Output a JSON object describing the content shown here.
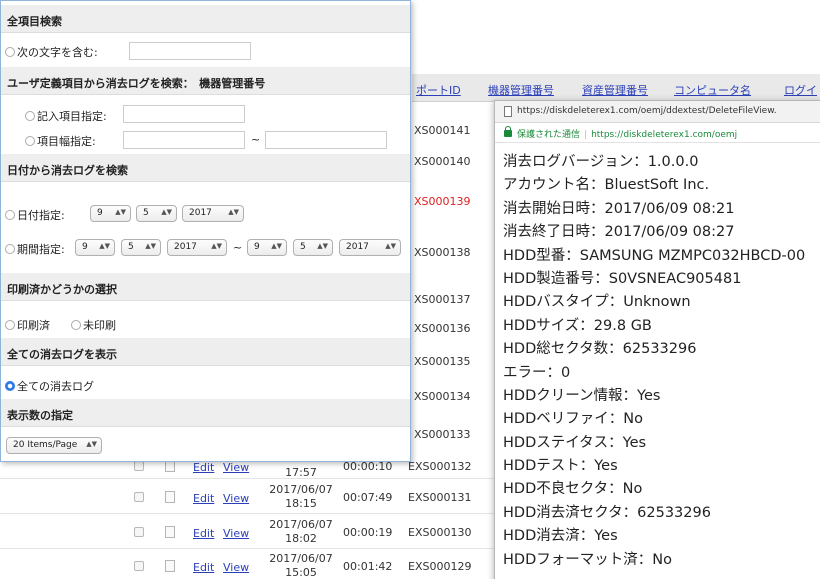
{
  "search_panel": {
    "all_items_title": "全項目検索",
    "contains_label": "次の文字を含む:",
    "user_defined_title": "ユーザ定義項目から消去ログを検索：　機器管理番号",
    "entry_spec_label": "記入項目指定:",
    "range_spec_label": "項目幅指定:",
    "tilde": "~",
    "date_title": "日付から消去ログを検索",
    "date_spec_label": "日付指定:",
    "date_spec": {
      "month": "9",
      "day": "5",
      "year": "2017"
    },
    "period_spec_label": "期間指定:",
    "period_from": {
      "month": "9",
      "day": "5",
      "year": "2017"
    },
    "period_to": {
      "month": "9",
      "day": "5",
      "year": "2017"
    },
    "printed_title": "印刷済かどうかの選択",
    "printed_label": "印刷済",
    "unprinted_label": "未印刷",
    "show_all_title": "全ての消去ログを表示",
    "all_logs_label": "全ての消去ログ",
    "display_count_title": "表示数の指定",
    "items_per_page": "20 Items/Page"
  },
  "table": {
    "headers": [
      "ポートID",
      "機器管理番号",
      "資産管理番号",
      "コンピュータ名",
      "ログイ"
    ],
    "ids": [
      "XS000141",
      "XS000140",
      "XS000139",
      "XS000138",
      "XS000137",
      "XS000136",
      "XS000135",
      "XS000134",
      "XS000133",
      "EXS000132",
      "EXS000131",
      "EXS000130",
      "EXS000129"
    ],
    "highlight_id": "XS000139",
    "visible_rows": [
      {
        "edit": "Edit",
        "view": "View",
        "date": "",
        "time": "17:57",
        "duration": "00:00:10",
        "id": "EXS000132"
      },
      {
        "edit": "Edit",
        "view": "View",
        "date": "2017/06/07",
        "time": "18:15",
        "duration": "00:07:49",
        "id": "EXS000131"
      },
      {
        "edit": "Edit",
        "view": "View",
        "date": "2017/06/07",
        "time": "18:02",
        "duration": "00:00:19",
        "id": "EXS000130"
      },
      {
        "edit": "Edit",
        "view": "View",
        "date": "2017/06/07",
        "time": "15:05",
        "duration": "00:01:42",
        "id": "EXS000129"
      }
    ]
  },
  "popup": {
    "url": "https://diskdeleterex1.com/oemj/ddextest/DeleteFileView.",
    "secure_label": "保護された通信",
    "secure_url": "https://diskdeleterex1.com/oemj",
    "lines": [
      "消去ログバージョン：1.0.0.0",
      "アカウント名：BluestSoft Inc.",
      "消去開始日時：2017/06/09 08:21",
      "消去終了日時：2017/06/09 08:27",
      "HDD型番：SAMSUNG MZMPC032HBCD-00",
      "HDD製造番号：S0VSNEAC905481",
      "HDDバスタイプ：Unknown",
      "HDDサイズ：29.8 GB",
      "HDD総セクタ数：62533296",
      "エラー：0",
      "HDDクリーン情報：Yes",
      "HDDベリファイ：No",
      "HDDステイタス：Yes",
      "HDDテスト：Yes",
      "HDD不良セクタ：No",
      "HDD消去済セクタ：62533296",
      "HDD消去済：Yes",
      "HDDフォーマット済：No"
    ]
  },
  "colors": {
    "accent": "#2c7be5",
    "link": "#2b3fb8",
    "highlight": "#e02020",
    "secure": "#1a8a3a"
  }
}
